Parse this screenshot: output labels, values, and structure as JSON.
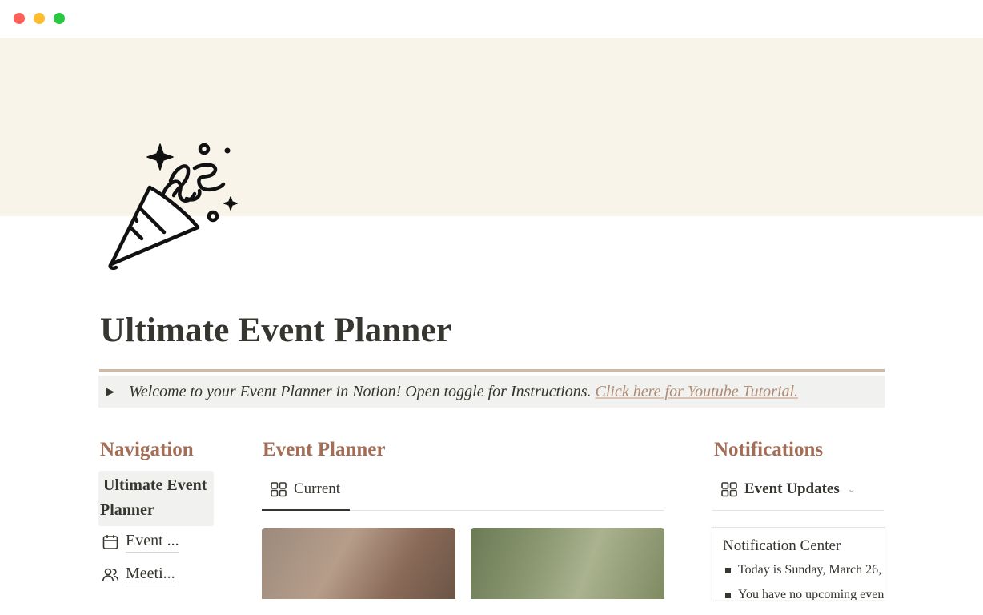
{
  "window": {
    "controls": [
      "close",
      "minimize",
      "zoom"
    ]
  },
  "page": {
    "title": "Ultimate Event Planner",
    "icon": "party-popper-icon"
  },
  "callout": {
    "text": "Welcome to your Event Planner in Notion! Open toggle for Instructions.",
    "link": "Click here for Youtube Tutorial."
  },
  "navigation": {
    "heading": "Navigation",
    "active_item": "Ultimate Event Planner",
    "items": [
      {
        "label": "Event ...",
        "icon": "calendar-icon"
      },
      {
        "label": "Meeti...",
        "icon": "people-icon"
      }
    ]
  },
  "event_planner": {
    "heading": "Event Planner",
    "view_tab": "Current",
    "view_icon": "gallery-view-icon"
  },
  "notifications": {
    "heading": "Notifications",
    "view_tab": "Event Updates",
    "view_icon": "gallery-view-icon",
    "card_title": "Notification Center",
    "lines": [
      "Today is Sunday, March 26,",
      "You have no upcoming even"
    ]
  },
  "colors": {
    "cover": "#f8f4ea",
    "heading_accent": "#a46d55",
    "link": "#b08b75",
    "divider": "#cdb9a5",
    "callout_bg": "#f1f1ef"
  }
}
